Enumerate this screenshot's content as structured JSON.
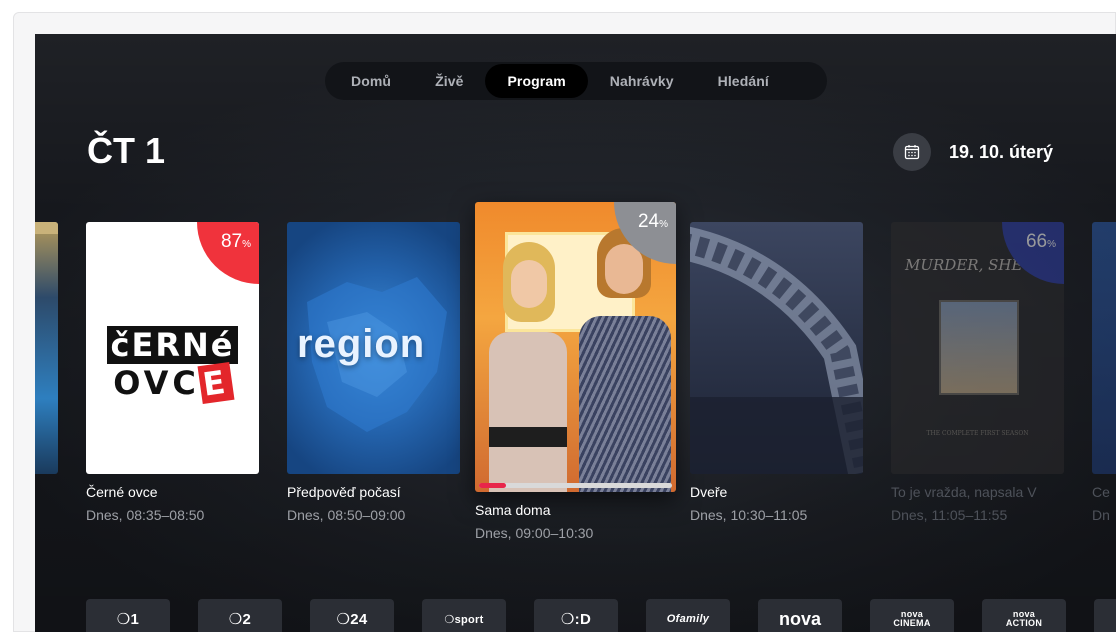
{
  "nav": {
    "tabs": [
      {
        "label": "Domů"
      },
      {
        "label": "Živě"
      },
      {
        "label": "Program"
      },
      {
        "label": "Nahrávky"
      },
      {
        "label": "Hledání"
      }
    ],
    "active": "Program"
  },
  "header": {
    "channel": "ČT 1",
    "date": "19. 10. úterý",
    "calendar_icon": "calendar-icon"
  },
  "programs": [
    {
      "title": "Černé ovce",
      "time": "Dnes, 08:35–08:50",
      "badge": "87",
      "badge_unit": "%",
      "badge_color": "#f0333c",
      "logo_line1": "čERNé",
      "logo_line2": "OVC",
      "logo_accent": "E"
    },
    {
      "title": "Předpověď počasí",
      "time": "Dnes, 08:50–09:00",
      "poster_text": "region"
    },
    {
      "title": "Sama doma",
      "time": "Dnes, 09:00–10:30",
      "badge": "24",
      "badge_unit": "%",
      "badge_color": "#8d8f94",
      "progress": 0.14,
      "progress_color": "#e8264a"
    },
    {
      "title": "Dveře",
      "time": "Dnes, 10:30–11:05"
    },
    {
      "title": "To je vražda, napsala V",
      "time": "Dnes, 11:05–11:55",
      "badge": "66",
      "badge_unit": "%",
      "badge_color": "#2f3fa8",
      "poster_text": "MURDER, SHE WR",
      "poster_subtext": "THE COMPLETE FIRST SEASON"
    },
    {
      "title": "Ce",
      "time": "Dn"
    }
  ],
  "channels": [
    "❍1",
    "❍2",
    "❍24",
    "❍sport",
    "❍:D",
    "Ofamily",
    "nova",
    "nova CINEMA",
    "nova ACTION"
  ],
  "colors": {
    "background": "#1d2026",
    "nav_bg": "#121418",
    "accent_red": "#e8264a"
  }
}
